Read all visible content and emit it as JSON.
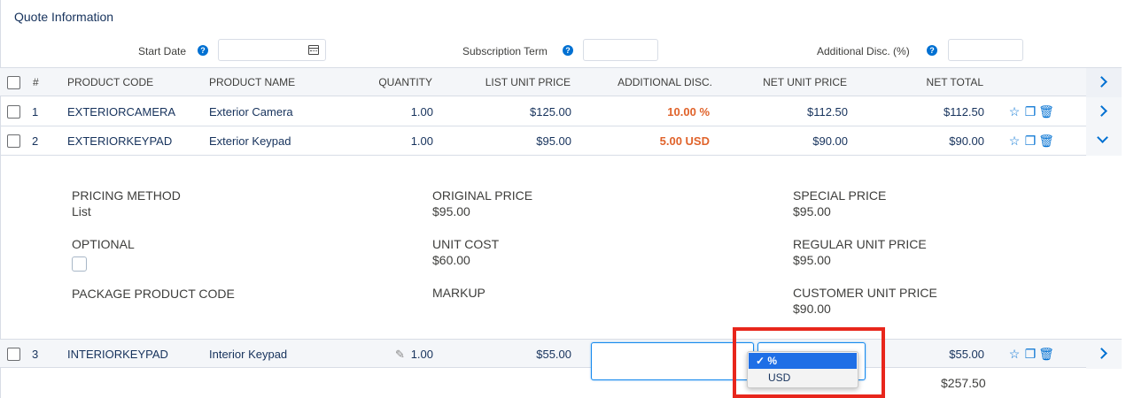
{
  "section_title": "Quote Information",
  "fields": {
    "start_date": {
      "label": "Start Date",
      "value": ""
    },
    "subscription_term": {
      "label": "Subscription Term",
      "value": ""
    },
    "additional_disc": {
      "label": "Additional Disc. (%)",
      "value": ""
    }
  },
  "table": {
    "headers": {
      "num": "#",
      "code": "PRODUCT CODE",
      "name": "PRODUCT NAME",
      "qty": "QUANTITY",
      "list": "LIST UNIT PRICE",
      "disc": "ADDITIONAL DISC.",
      "net_unit": "NET UNIT PRICE",
      "net_total": "NET TOTAL"
    },
    "rows": [
      {
        "num": "1",
        "code": "EXTERIORCAMERA",
        "name": "Exterior Camera",
        "qty": "1.00",
        "list": "$125.00",
        "disc": "10.00 %",
        "net_unit": "$112.50",
        "net_total": "$112.50"
      },
      {
        "num": "2",
        "code": "EXTERIORKEYPAD",
        "name": "Exterior Keypad",
        "qty": "1.00",
        "list": "$95.00",
        "disc": "5.00 USD",
        "net_unit": "$90.00",
        "net_total": "$90.00"
      },
      {
        "num": "3",
        "code": "INTERIORKEYPAD",
        "name": "Interior Keypad",
        "qty": "1.00",
        "list": "$55.00",
        "disc": "",
        "net_unit": "",
        "net_total": "$55.00"
      }
    ],
    "grand_total": "$257.50"
  },
  "detail": {
    "pricing_method": {
      "label": "PRICING METHOD",
      "value": "List"
    },
    "original_price": {
      "label": "ORIGINAL PRICE",
      "value": "$95.00"
    },
    "special_price": {
      "label": "SPECIAL PRICE",
      "value": "$95.00"
    },
    "optional": {
      "label": "OPTIONAL"
    },
    "unit_cost": {
      "label": "UNIT COST",
      "value": "$60.00"
    },
    "regular_unit_price": {
      "label": "REGULAR UNIT PRICE",
      "value": "$95.00"
    },
    "package_product_code": {
      "label": "PACKAGE PRODUCT CODE"
    },
    "markup": {
      "label": "MARKUP"
    },
    "customer_unit_price": {
      "label": "CUSTOMER UNIT PRICE",
      "value": "$90.00"
    }
  },
  "dropdown": {
    "options": [
      "%",
      "USD"
    ],
    "selected": "%"
  },
  "icons": {
    "help": "help-icon",
    "calendar": "calendar-icon",
    "favorite": "star-icon",
    "clone": "clone-icon",
    "delete": "trash-icon",
    "expand": "chevron-right-icon",
    "collapse": "chevron-down-icon",
    "edit": "pencil-icon"
  },
  "colors": {
    "accent": "#0070d2",
    "discount": "#e0632b",
    "highlight": "#e8261c"
  }
}
